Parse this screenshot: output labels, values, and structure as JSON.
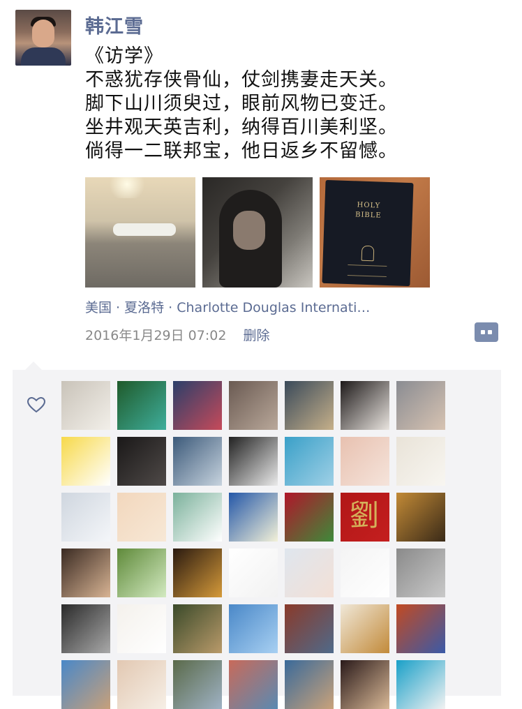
{
  "post": {
    "author": "韩江雪",
    "poem": [
      "《访学》",
      "不惑犹存侠骨仙，仗剑携妻走天关。",
      "脚下山川须臾过，眼前风物已变迁。",
      "坐井观天英吉利，纳得百川美利坚。",
      "倘得一二联邦宝，他日返乡不留憾。"
    ],
    "photos": [
      "airport",
      "hooded-person",
      "holy-bible"
    ],
    "photo_text": {
      "bible_title": "HOLY\nBIBLE"
    },
    "location": "美国 · 夏洛特 · Charlotte Douglas Internati…",
    "timestamp": "2016年1月29日 07:02",
    "delete_label": "删除"
  },
  "likes": {
    "icon": "heart-icon",
    "liker_glyph": "劉",
    "avatars": [
      {
        "c1": "#c9c3b9",
        "c2": "#f2efe9"
      },
      {
        "c1": "#1f5a2a",
        "c2": "#3fae9c"
      },
      {
        "c1": "#2b3f6a",
        "c2": "#c64a5a"
      },
      {
        "c1": "#6a5a52",
        "c2": "#b9a89a"
      },
      {
        "c1": "#3a4a5a",
        "c2": "#c6b08a"
      },
      {
        "c1": "#1e1a1a",
        "c2": "#e9e4df"
      },
      {
        "c1": "#8a8c92",
        "c2": "#d7c3b2"
      },
      {
        "c1": "#f7d94a",
        "c2": "#ffffff"
      },
      {
        "c1": "#1a1818",
        "c2": "#4f4a48"
      },
      {
        "c1": "#3c5a7a",
        "c2": "#c7d3de"
      },
      {
        "c1": "#222222",
        "c2": "#eaeaea"
      },
      {
        "c1": "#3aa0c8",
        "c2": "#9fd0e6"
      },
      {
        "c1": "#e8c1b0",
        "c2": "#f5e4db"
      },
      {
        "c1": "#e9e3d8",
        "c2": "#f8f6f1"
      },
      {
        "c1": "#cfd6df",
        "c2": "#f4f6f9"
      },
      {
        "c1": "#f2d7bd",
        "c2": "#f7e8d6"
      },
      {
        "c1": "#7bb19b",
        "c2": "#ffffff"
      },
      {
        "c1": "#2457a8",
        "c2": "#f3f1d8"
      },
      {
        "c1": "#b0162a",
        "c2": "#3e8a3a"
      },
      {
        "c1": "#b11717",
        "c2": "#c41f1f"
      },
      {
        "c1": "#c28a36",
        "c2": "#3a2a18"
      },
      {
        "c1": "#3a2a22",
        "c2": "#d8b494"
      },
      {
        "c1": "#5f8a3a",
        "c2": "#d3eac1"
      },
      {
        "c1": "#2a1a10",
        "c2": "#d59a3a"
      },
      {
        "c1": "#ffffff",
        "c2": "#f2f2f2"
      },
      {
        "c1": "#dfe6ee",
        "c2": "#f3e0d6"
      },
      {
        "c1": "#f4f4f4",
        "c2": "#ffffff"
      },
      {
        "c1": "#8a8a8a",
        "c2": "#c9c9c9"
      },
      {
        "c1": "#2a2a2a",
        "c2": "#a9a9a9"
      },
      {
        "c1": "#f4f1ec",
        "c2": "#ffffff"
      },
      {
        "c1": "#3a4a2a",
        "c2": "#b99a6a"
      },
      {
        "c1": "#4a88c8",
        "c2": "#a8d0f2"
      },
      {
        "c1": "#8a3a2a",
        "c2": "#4f6a8a"
      },
      {
        "c1": "#f0e8d8",
        "c2": "#c28a3a"
      },
      {
        "c1": "#c24a22",
        "c2": "#3a5aa8"
      },
      {
        "c1": "#4a88c8",
        "c2": "#c7a07a"
      },
      {
        "c1": "#e2c8b2",
        "c2": "#f6efe6"
      },
      {
        "c1": "#5a6a4a",
        "c2": "#9fb2c4"
      },
      {
        "c1": "#c86a5a",
        "c2": "#5a8ab2"
      },
      {
        "c1": "#3a6a9a",
        "c2": "#c9a27a"
      },
      {
        "c1": "#2a1a1a",
        "c2": "#d8b896"
      },
      {
        "c1": "#1aa0c8",
        "c2": "#f2f2f2"
      }
    ]
  }
}
